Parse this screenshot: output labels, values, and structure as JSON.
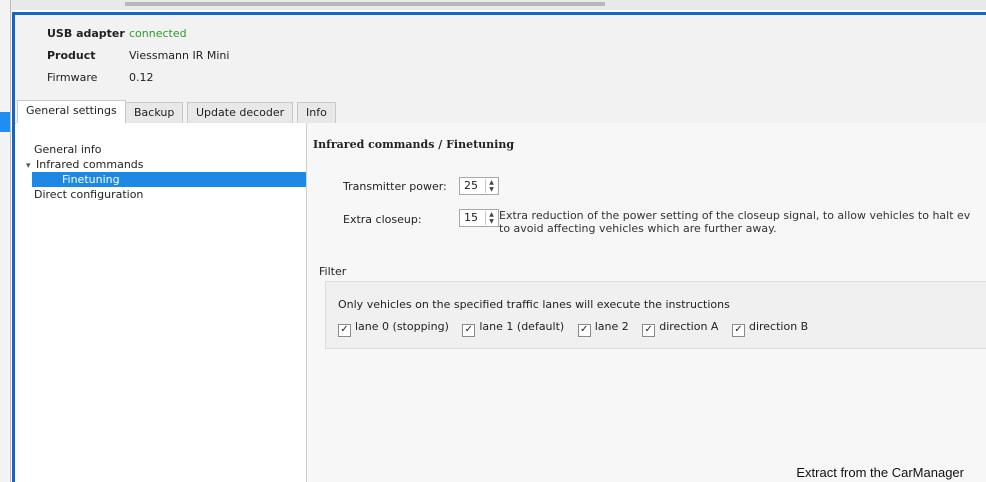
{
  "header": {
    "usb_label": "USB adapter",
    "usb_status": "connected",
    "product_label": "Product",
    "product_value": "Viessmann IR Mini",
    "firmware_label": "Firmware",
    "firmware_value": "0.12"
  },
  "tabs": [
    {
      "label": "General settings",
      "active": true
    },
    {
      "label": "Backup",
      "active": false
    },
    {
      "label": "Update decoder",
      "active": false
    },
    {
      "label": "Info",
      "active": false
    }
  ],
  "tree": [
    {
      "label": "General info"
    },
    {
      "label": "Infrared commands",
      "expanded": true
    },
    {
      "label": "Finetuning",
      "selected": true
    },
    {
      "label": "Direct configuration"
    }
  ],
  "panel": {
    "title": "Infrared commands / Finetuning",
    "transmitter_label": "Transmitter power:",
    "transmitter_value": "25",
    "closeup_label": "Extra closeup:",
    "closeup_value": "15",
    "closeup_desc_line1": "Extra reduction of the power setting of the closeup signal, to allow vehicles to halt ev",
    "closeup_desc_line2": "to avoid affecting vehicles which are further away.",
    "filter_label": "Filter",
    "filter_desc": "Only vehicles on the specified traffic lanes will execute the instructions",
    "checkboxes": [
      {
        "label": "lane 0 (stopping)",
        "checked": true
      },
      {
        "label": "lane 1 (default)",
        "checked": true
      },
      {
        "label": "lane 2",
        "checked": true
      },
      {
        "label": "direction A",
        "checked": true
      },
      {
        "label": "direction B",
        "checked": true
      }
    ]
  },
  "caption": "Extract from the CarManager",
  "colors": {
    "accent": "#1565c0",
    "selection": "#1e88e5",
    "connected": "#2e9b2e"
  }
}
